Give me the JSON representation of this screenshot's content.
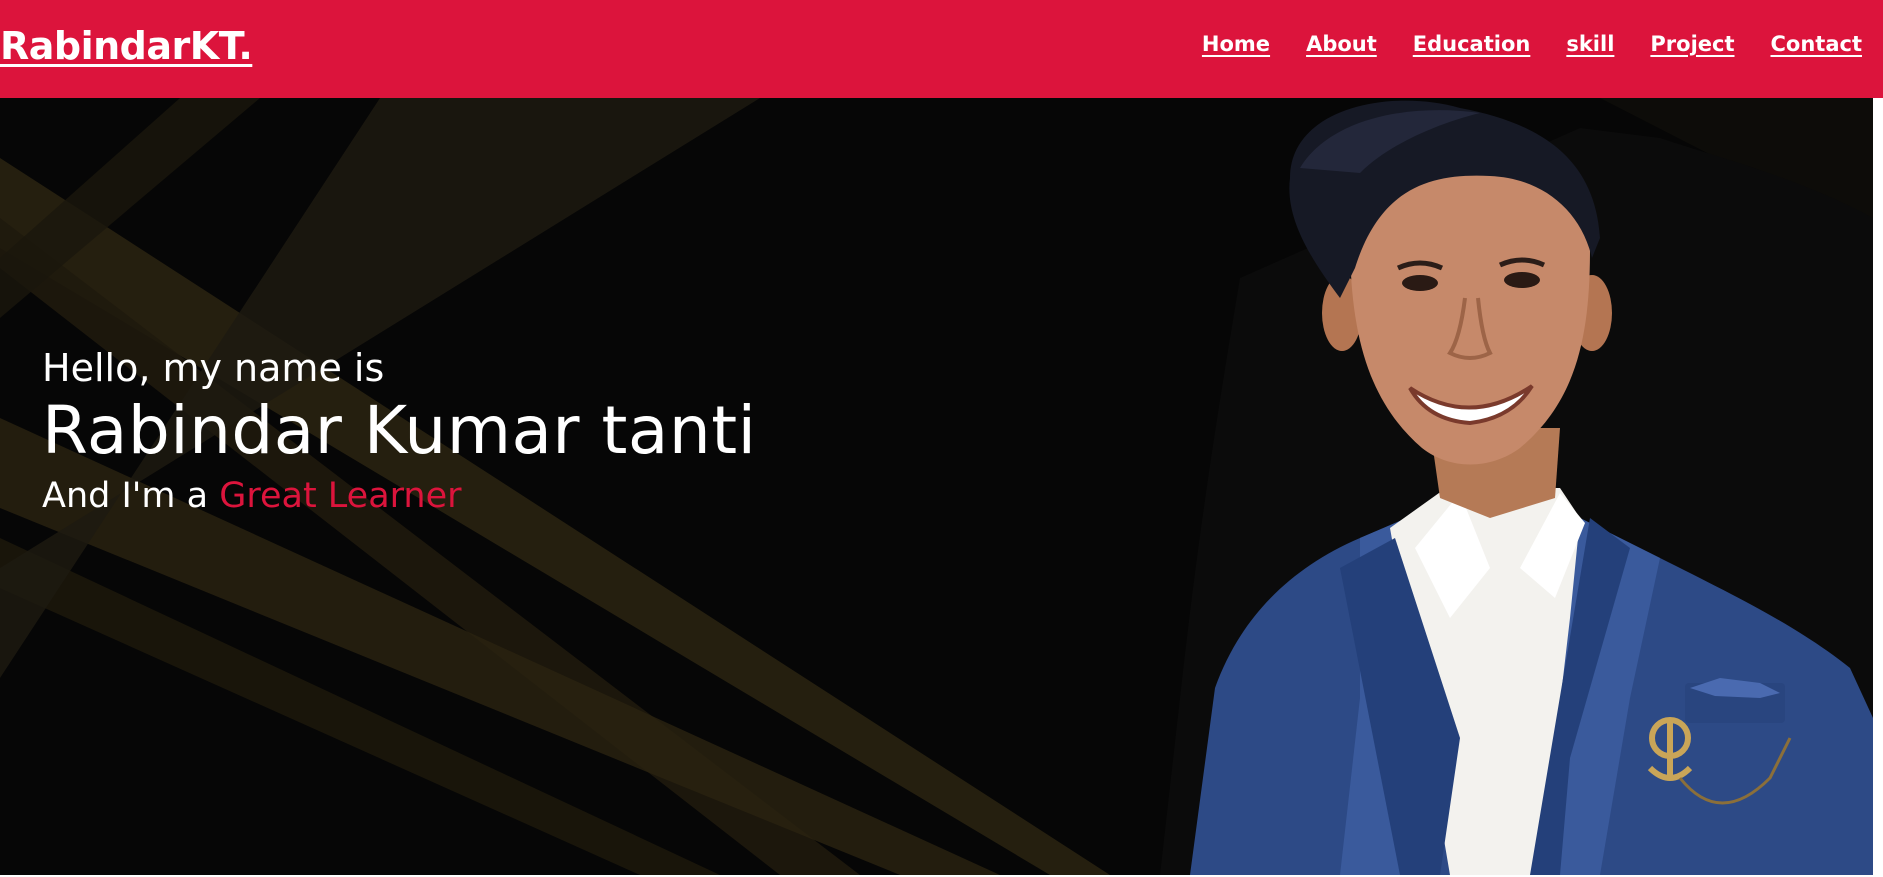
{
  "navbar": {
    "logo": "RabindarKT.",
    "background": "#dc143c",
    "links": [
      {
        "label": "Home"
      },
      {
        "label": "About"
      },
      {
        "label": "Education"
      },
      {
        "label": "skill"
      },
      {
        "label": "Project"
      },
      {
        "label": "Contact"
      }
    ]
  },
  "hero": {
    "greeting": "Hello, my name is",
    "name": "Rabindar Kumar tanti",
    "tagline_prefix": "And I'm a ",
    "tagline_highlight": "Great Learner",
    "highlight_color": "#dc143c",
    "background_color": "#060606",
    "portrait_icon": "profile-photo"
  }
}
